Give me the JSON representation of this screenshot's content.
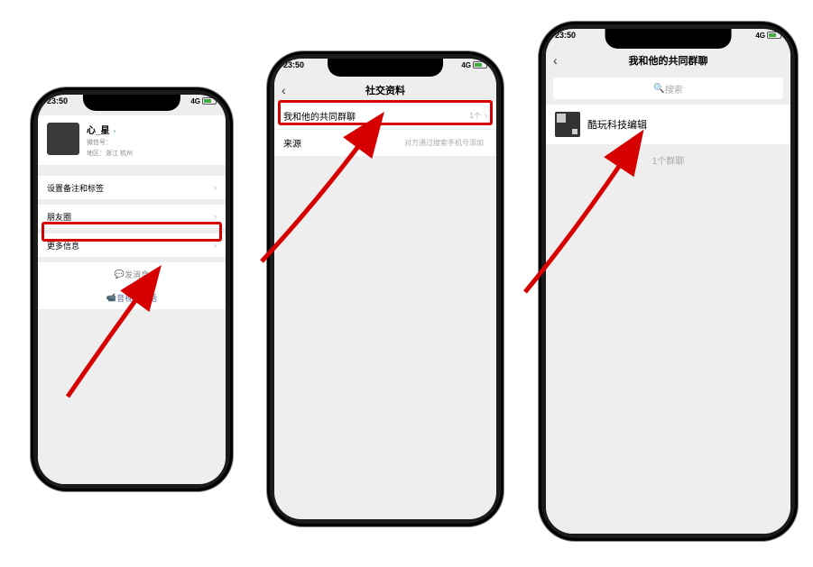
{
  "status": {
    "time": "23:50",
    "signal": "4G"
  },
  "phone1": {
    "name": "心_星",
    "wechat_id": "微信号：",
    "region": "地区：浙江 杭州",
    "rows": {
      "remark": "设置备注和标签",
      "moments": "朋友圈",
      "more_info": "更多信息"
    },
    "send_msg": "发消息",
    "video_call": "音视频通话"
  },
  "phone2": {
    "title": "社交资料",
    "common_groups_label": "我和他的共同群聊",
    "common_groups_count": "1个",
    "source_label": "来源",
    "source_value": "对方通过搜索手机号添加"
  },
  "phone3": {
    "title": "我和他的共同群聊",
    "search_placeholder": "搜索",
    "group_name": "酷玩科技编辑",
    "group_count": "1个群聊"
  }
}
